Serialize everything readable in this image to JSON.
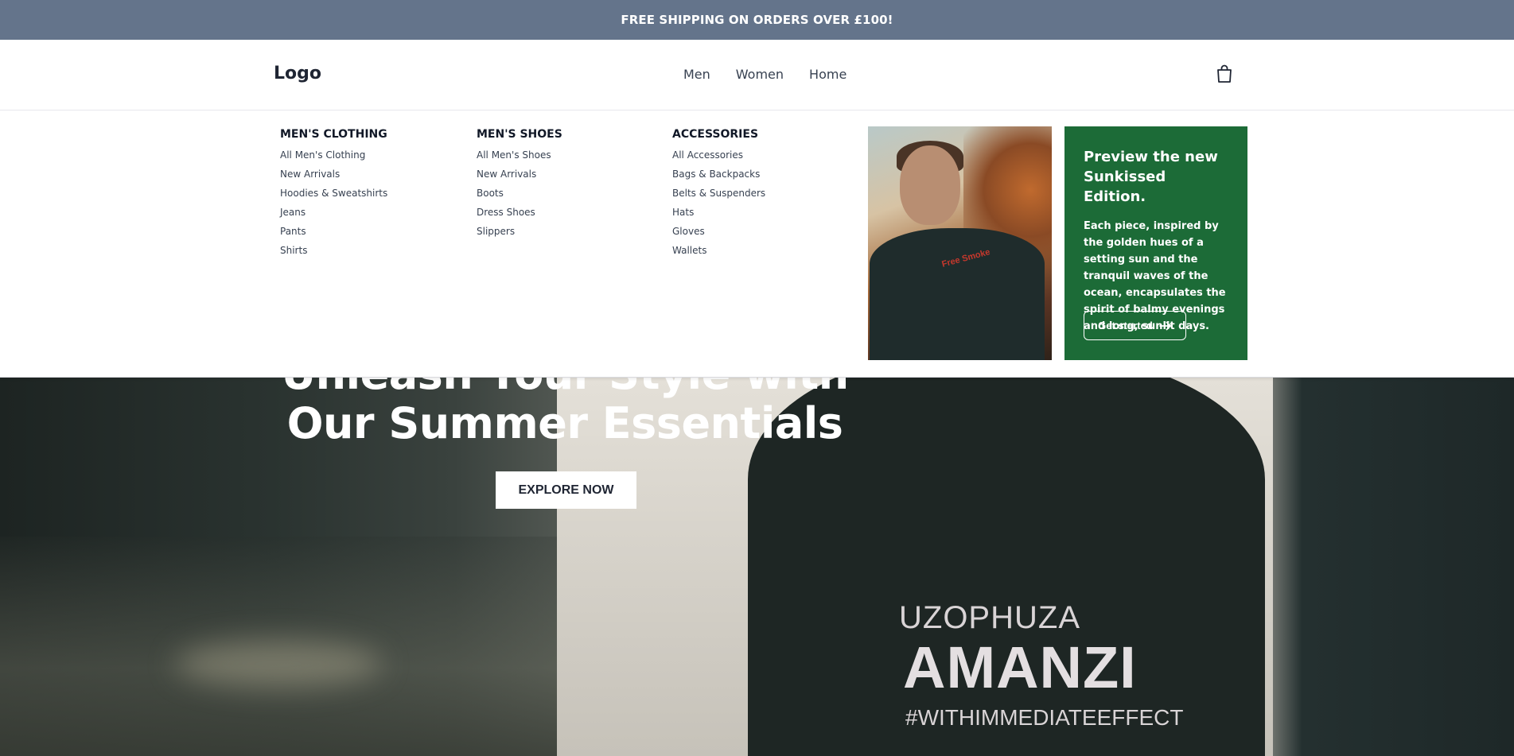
{
  "announcement": {
    "text": "FREE SHIPPING ON ORDERS OVER £100!"
  },
  "header": {
    "logo": "Logo",
    "nav": [
      "Men",
      "Women",
      "Home"
    ],
    "cart_icon": "shopping-bag-icon"
  },
  "mega_menu": {
    "columns": [
      {
        "title": "MEN'S CLOTHING",
        "items": [
          "All Men's Clothing",
          "New Arrivals",
          "Hoodies & Sweatshirts",
          "Jeans",
          "Pants",
          "Shirts"
        ]
      },
      {
        "title": "MEN'S SHOES",
        "items": [
          "All Men's Shoes",
          "New Arrivals",
          "Boots",
          "Dress Shoes",
          "Slippers"
        ]
      },
      {
        "title": "ACCESSORIES",
        "items": [
          "All Accessories",
          "Bags & Backpacks",
          "Belts & Suspenders",
          "Hats",
          "Gloves",
          "Wallets"
        ]
      }
    ],
    "promo": {
      "title": "Preview the new Sunkissed Edition.",
      "body": "Each piece, inspired by the golden hues of a setting sun and the tranquil waves of the ocean, encapsulates the spirit of balmy evenings and long, sunlit days.",
      "button": "Get started",
      "button_icon": "arrow-right-icon",
      "color": "#1c6b37"
    },
    "photo_print": "Free Smoke"
  },
  "hero": {
    "title": "Unleash Your Style with Our Summer Essentials",
    "button": "EXPLORE NOW",
    "print_line1": "UZOPHUZA",
    "print_line2": "AMANZI",
    "print_line3": "#WITHIMMEDIATEEFFECT"
  },
  "colors": {
    "announcement_bg": "#64748b",
    "promo_bg": "#1c6b37"
  }
}
